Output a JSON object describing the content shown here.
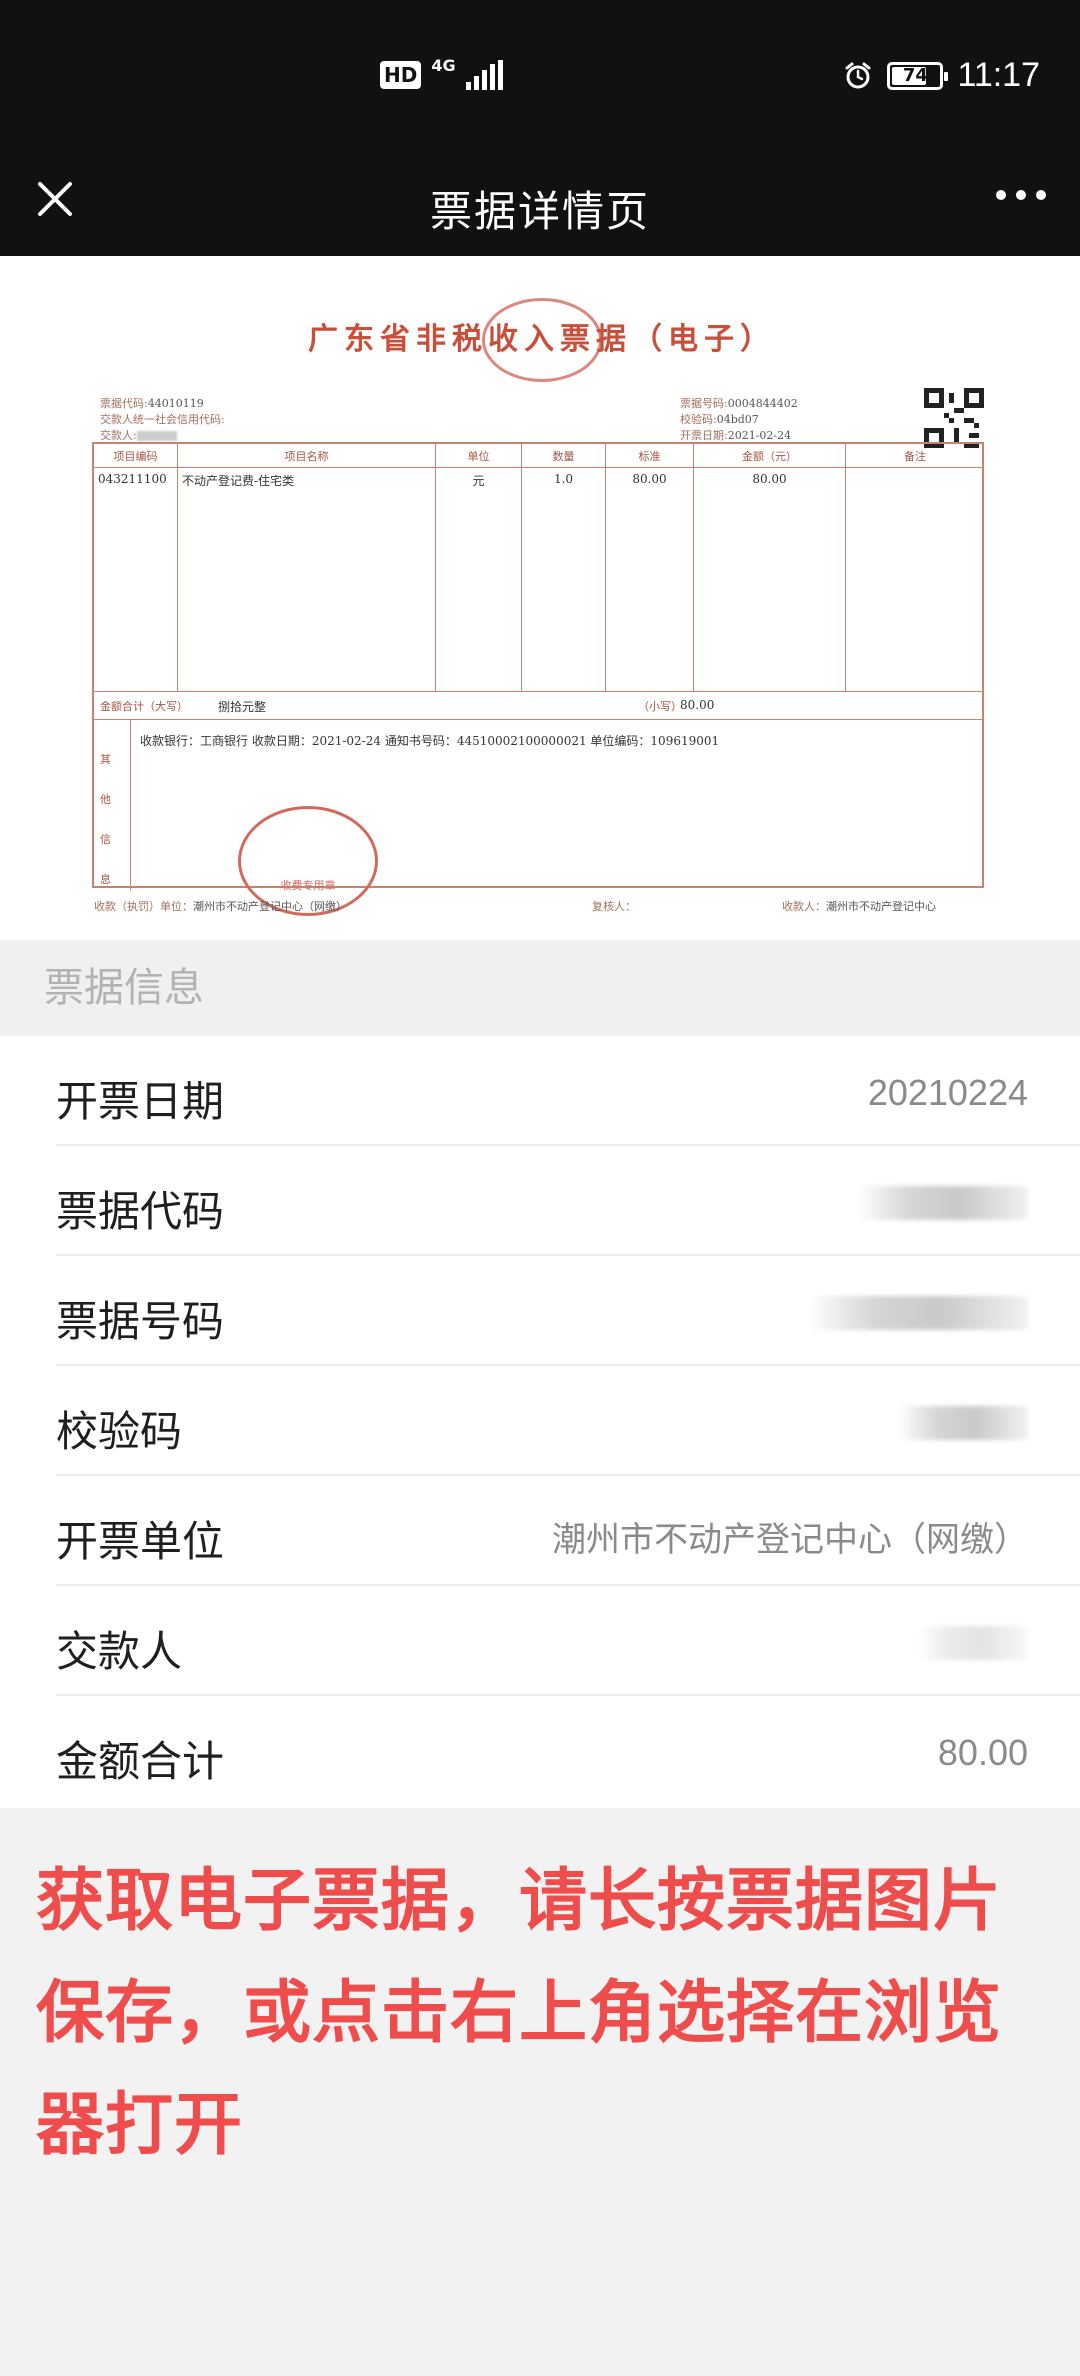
{
  "status_bar": {
    "hd": "HD",
    "network": "4G",
    "battery": "74",
    "battery_fraction": 0.74,
    "time": "11:17"
  },
  "nav": {
    "title": "票据详情页",
    "close_icon": "close-icon",
    "more_icon": "more-icon"
  },
  "receipt": {
    "title": "广东省非税收入票据（电子）",
    "code_label": "票据代码:",
    "code": "44010119",
    "payer_credit_label": "交款人统一社会信用代码:",
    "payer_label": "交款人:",
    "number_label": "票据号码:",
    "number": "0004844402",
    "check_label": "校验码:",
    "check": "04bd07",
    "date_label": "开票日期:",
    "date": "2021-02-24",
    "columns": [
      "项目编码",
      "项目名称",
      "单位",
      "数量",
      "标准",
      "金额（元）",
      "备注"
    ],
    "items": [
      {
        "code": "043211100",
        "name": "不动产登记费-住宅类",
        "unit": "元",
        "qty": "1.0",
        "std": "80.00",
        "amount": "80.00",
        "note": ""
      }
    ],
    "total_label": "金额合计（大写）",
    "total_upper": "捌拾元整",
    "total_small_label": "（小写）",
    "total_small": "80.00",
    "other_label": "其他信息",
    "other_info": "收款银行：工商银行  收款日期：2021-02-24  通知书号码：44510002100000021  单位编码：109619001",
    "seal_text": "收费专用章",
    "issuer_label": "收款（执罚）单位：",
    "issuer": "潮州市不动产登记中心（网缴）",
    "reviewer_label": "复核人：",
    "receiver_label": "收款人：",
    "receiver": "潮州市不动产登记中心"
  },
  "section": {
    "title": "票据信息"
  },
  "info": [
    {
      "label": "开票日期",
      "value": "20210224",
      "blurred": false
    },
    {
      "label": "票据代码",
      "value": "",
      "blurred": true
    },
    {
      "label": "票据号码",
      "value": "",
      "blurred": true
    },
    {
      "label": "校验码",
      "value": "",
      "blurred": true
    },
    {
      "label": "开票单位",
      "value": "潮州市不动产登记中心（网缴）",
      "blurred": false
    },
    {
      "label": "交款人",
      "value": "",
      "blurred": true
    },
    {
      "label": "金额合计",
      "value": "80.00",
      "blurred": false
    }
  ],
  "notice": "获取电子票据，请长按票据图片保存，或点击右上角选择在浏览器打开",
  "colors": {
    "top_bar": "#111111",
    "notice": "#ef4c4c",
    "receipt_accent": "#c84f3a"
  }
}
